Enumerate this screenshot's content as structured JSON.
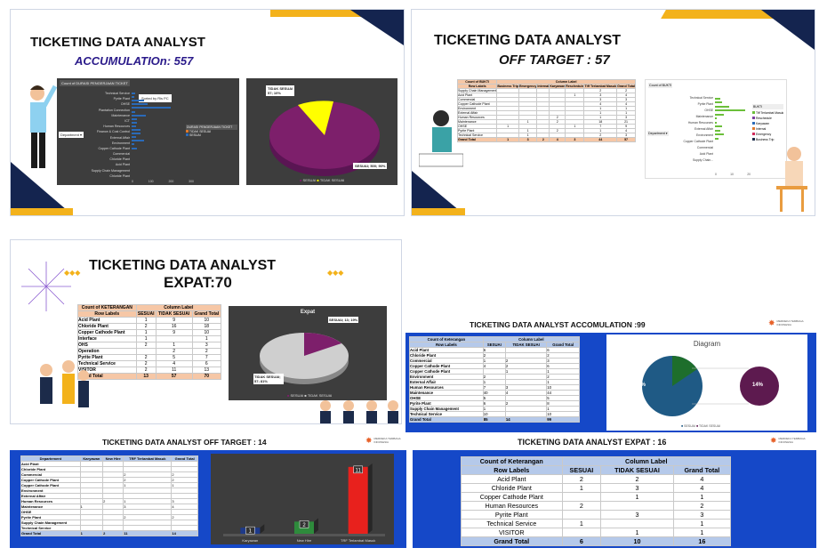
{
  "brand": {
    "navy": "#14244f",
    "gold": "#f3b21b",
    "blue": "#1548c8",
    "pink": "#7d1f6b",
    "yellow": "#ffff00"
  },
  "slide1": {
    "title": "TICKETING DATA ANALYST",
    "subtitle": "ACCUMULATIOn: 557",
    "bar_header": "Count of DURASI PENGERJAAN TICKET",
    "filter_department": "Department",
    "legend_header": "DURASI PENGERJAAN TICKET",
    "legend_items": [
      "TIDAK SESUAI",
      "SESUAI"
    ],
    "tooltip": "Sorted by Ris PC",
    "x_ticks": [
      "0",
      "100",
      "200",
      "300"
    ],
    "categories": [
      "Technical Service",
      "Pyrite Plant",
      "OHSE",
      "Plantation Connection",
      "Maintenance",
      "ICT",
      "Human Resources",
      "Finance & Cost Control",
      "External Affair",
      "Environment",
      "Copper Cathode Plant",
      "Commercial",
      "Chloride Plant",
      "Acid Plant",
      "Supply Chain Management",
      "Chloride Plant"
    ],
    "pie": {
      "label_a": "TIDAK SESUAI\n57; 10%",
      "label_b": "SESUAI; 500; 90%",
      "legend": [
        "SESUAI",
        "TIDAK SESUAI"
      ]
    }
  },
  "slide2": {
    "title": "TICKETING DATA ANALYST",
    "subtitle": "OFF TARGET : 57",
    "pivot_title": "Count of BUKTI",
    "col_label": "Column Label",
    "row_labels": "Row Labels",
    "columns": [
      "Business Trip",
      "Emergency",
      "Internal",
      "Karyawan",
      "Reschedule",
      "Tiff Terlambat Masuk",
      "Grand Total"
    ],
    "rows": [
      [
        "Supply Chain Management",
        "",
        "",
        "",
        "",
        "",
        "2",
        "2"
      ],
      [
        "Acid Plant",
        "",
        "",
        "",
        "",
        "1",
        "3",
        "4"
      ],
      [
        "Commercial",
        "",
        "",
        "",
        "",
        "",
        "3",
        "3"
      ],
      [
        "Copper Cathode Plant",
        "",
        "",
        "",
        "",
        "",
        "4",
        "4"
      ],
      [
        "Environment",
        "",
        "",
        "",
        "",
        "",
        "1",
        "1"
      ],
      [
        "External Affair",
        "",
        "",
        "",
        "",
        "",
        "1",
        "1"
      ],
      [
        "Human Resources",
        "",
        "",
        "",
        "2",
        "",
        "1",
        "3"
      ],
      [
        "Maintenance",
        "",
        "1",
        "",
        "2",
        "",
        "18",
        "21"
      ],
      [
        "OHSE",
        "1",
        "",
        "",
        "",
        "1",
        "7",
        "9"
      ],
      [
        "Pyrite Plant",
        "",
        "1",
        "",
        "2",
        "",
        "1",
        "4"
      ],
      [
        "Technical Service",
        "",
        "1",
        "",
        "",
        "",
        "2",
        "3"
      ]
    ],
    "total": [
      "Grand Total",
      "1",
      "3",
      "2",
      "4",
      "3",
      "44",
      "57"
    ],
    "mini_title": "Count of BUKTI",
    "mini_filter": "Department",
    "mini_legend_header": "BUKTI",
    "mini_legend": [
      "Tiff Terlambat Masuk",
      "Reschedule",
      "Karyawan",
      "Internal",
      "Emergency",
      "Business Trip"
    ],
    "mini_categories": [
      "Technical Service",
      "Pyrite Plant",
      "OHSE",
      "Maintenance",
      "Human Resources",
      "External Affair",
      "Environment",
      "Copper Cathode Plant",
      "Commercial",
      "Acid Plant",
      "Supply Chain..."
    ],
    "mini_ticks": [
      "0",
      "10",
      "20"
    ]
  },
  "slide3": {
    "title": "TICKETING DATA ANALYST",
    "subtitle": "EXPAT:70",
    "pivot_title": "Count of KETERANGAN",
    "col_label": "Column Label",
    "row_labels": "Row Labels",
    "columns": [
      "SESUAI",
      "TIDAK SESUAI",
      "Grand Total"
    ],
    "rows": [
      [
        "Acid Plant",
        "1",
        "9",
        "10"
      ],
      [
        "Chloride Plant",
        "2",
        "16",
        "18"
      ],
      [
        "Copper Cathode Plant",
        "1",
        "9",
        "10"
      ],
      [
        "Interface",
        "1",
        "",
        "1"
      ],
      [
        "OHS",
        "2",
        "1",
        "3"
      ],
      [
        "Operation",
        "",
        "2",
        "2"
      ],
      [
        "Pyrite Plant",
        "2",
        "5",
        "7"
      ],
      [
        "Technical Service",
        "2",
        "4",
        "6"
      ],
      [
        "VISITOR",
        "2",
        "11",
        "13"
      ]
    ],
    "total": [
      "Grand Total",
      "13",
      "57",
      "70"
    ],
    "pie_title": "Expat",
    "pie_label_a": "SESUAI; 13; 19%",
    "pie_label_b": "TIDAK SESUAI; 57; 81%",
    "pie_legend": [
      "SESUAI",
      "TIDAK SESUAI"
    ]
  },
  "slide4": {
    "title": "TICKETING DATA ANALYST ACCOMULATION :99",
    "logo": "MERDEKA TEMBAGA INDONESIA",
    "pivot_title": "Count of Keterangan",
    "col_label": "Column Label",
    "row_labels": "Row Labels",
    "columns": [
      "SESUAI",
      "TIDAK SESUAI",
      "Grand Total"
    ],
    "rows": [
      [
        "Acid Plant",
        "6",
        "",
        "6"
      ],
      [
        "Chloride Plant",
        "2",
        "",
        "2"
      ],
      [
        "Commercial",
        "1",
        "2",
        "3"
      ],
      [
        "Copper Cathode Plant",
        "4",
        "2",
        "6"
      ],
      [
        "Copper Cathode Plant",
        "",
        "1",
        "1"
      ],
      [
        "Environment",
        "2",
        "",
        "2"
      ],
      [
        "External Affair",
        "1",
        "",
        "1"
      ],
      [
        "Human Resources",
        "7",
        "3",
        "10"
      ],
      [
        "Maintenance",
        "40",
        "4",
        "44"
      ],
      [
        "OHSE",
        "5",
        "",
        "5"
      ],
      [
        "Pyrite Plant",
        "6",
        "2",
        "8"
      ],
      [
        "Supply Chain Management",
        "1",
        "",
        "1"
      ],
      [
        "Technical Service",
        "10",
        "",
        "10"
      ]
    ],
    "total": [
      "Grand Total",
      "85",
      "14",
      "99"
    ],
    "diagram_title": "Diagram",
    "pct_a": "86%",
    "pct_b": "14%",
    "legend": [
      "SESUAI",
      "TIDAK SESUAI"
    ]
  },
  "slide5": {
    "title": "TICKETING DATA ANALYST OFF TARGET : 14",
    "logo": "MERDEKA TEMBAGA INDONESIA",
    "columns": [
      "Departement",
      "Karyawan",
      "New Hire",
      "TRF Terlambat Masuk",
      "Grand Total"
    ],
    "rows": [
      [
        "Acid Plant",
        "",
        "",
        "",
        ""
      ],
      [
        "Chloride Plant",
        "",
        "",
        "",
        ""
      ],
      [
        "Commercial",
        "",
        "",
        "2",
        "2"
      ],
      [
        "Copper Cathode Plant",
        "",
        "",
        "2",
        "2"
      ],
      [
        "Copper Cathode Plant",
        "",
        "",
        "1",
        "1"
      ],
      [
        "Environment",
        "",
        "",
        "",
        ""
      ],
      [
        "External Affair",
        "",
        "",
        "",
        ""
      ],
      [
        "Human Resources",
        "",
        "2",
        "1",
        "3"
      ],
      [
        "Maintenance",
        "1",
        "",
        "3",
        "4"
      ],
      [
        "OHSE",
        "",
        "",
        "",
        ""
      ],
      [
        "Pyrite Plant",
        "",
        "",
        "2",
        "2"
      ],
      [
        "Supply Chain Management",
        "",
        "",
        "",
        ""
      ],
      [
        "Technical Service",
        "",
        "",
        "",
        ""
      ]
    ],
    "total": [
      "Grand Total",
      "1",
      "2",
      "11",
      "14"
    ]
  },
  "slide5_chart": {
    "type": "bar",
    "categories": [
      "Karyawan",
      "New Hire",
      "TRF Terlambat Masuk"
    ],
    "values": [
      1,
      2,
      11
    ],
    "colors": [
      "#1e3a8a",
      "#2e8b3c",
      "#e8211d"
    ]
  },
  "slide6": {
    "title": "TICKETING DATA ANALYST  EXPAT : 16",
    "logo": "MERDEKA TEMBAGA INDONESIA",
    "pivot_title": "Count of Keterangan",
    "col_label": "Column Label",
    "row_labels": "Row Labels",
    "columns": [
      "SESUAI",
      "TIDAK SESUAI",
      "Grand Total"
    ],
    "rows": [
      [
        "Acid Plant",
        "2",
        "2",
        "4"
      ],
      [
        "Chloride Plant",
        "1",
        "3",
        "4"
      ],
      [
        "Copper Cathode Plant",
        "",
        "1",
        "1"
      ],
      [
        "Human Resources",
        "2",
        "",
        "2"
      ],
      [
        "Pyrite Plant",
        "",
        "3",
        "3"
      ],
      [
        "Technical Service",
        "1",
        "",
        "1"
      ],
      [
        "VISITOR",
        "",
        "1",
        "1"
      ]
    ],
    "total": [
      "Grand Total",
      "6",
      "10",
      "16"
    ]
  }
}
